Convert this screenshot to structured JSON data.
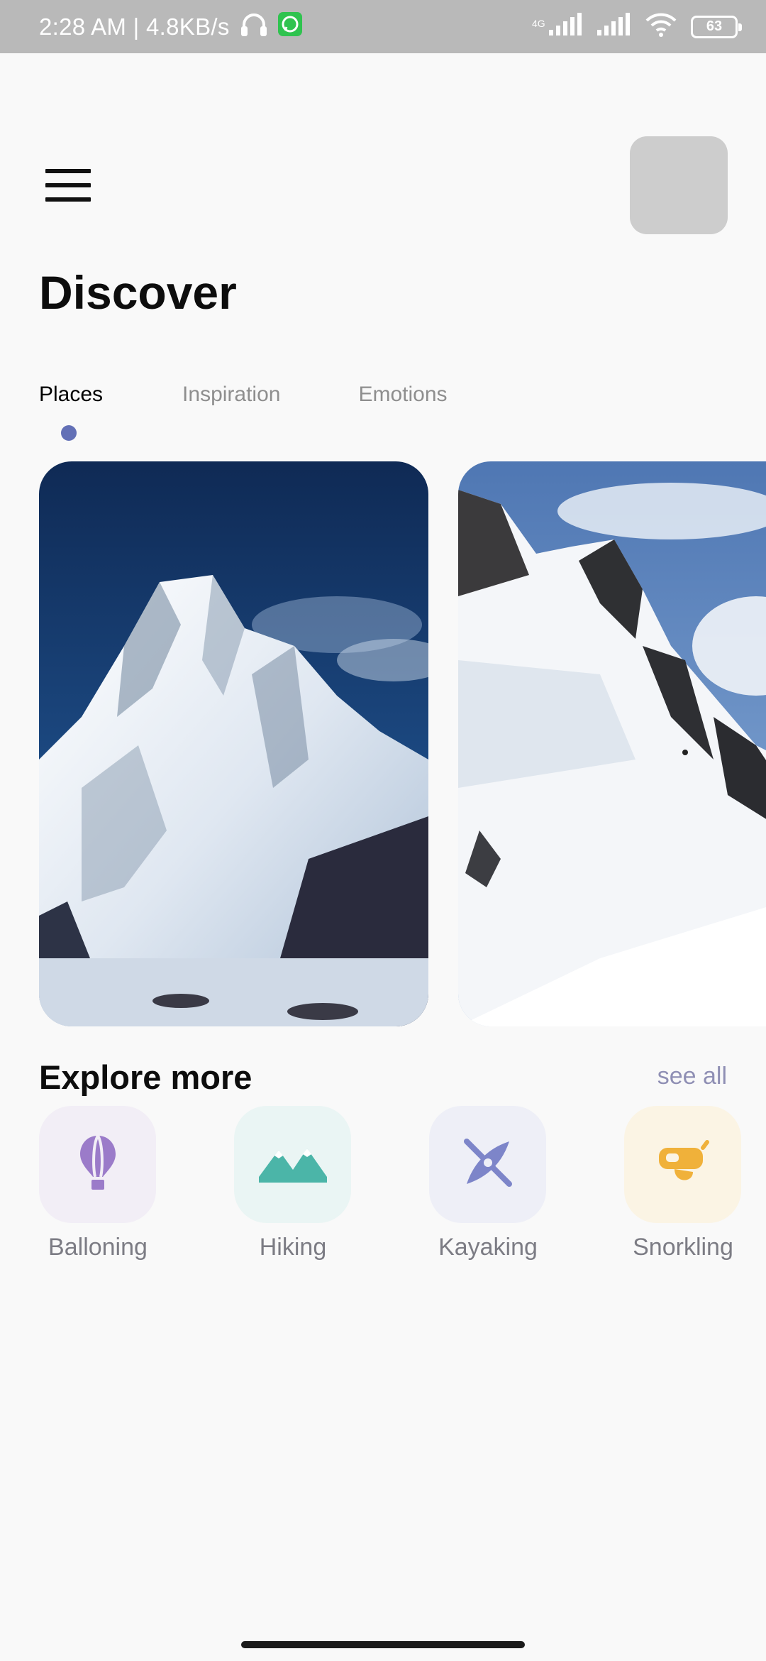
{
  "status_bar": {
    "time_speed": "2:28 AM | 4.8KB/s",
    "network": "4G",
    "battery": "63",
    "icons": [
      "headphones-icon",
      "whatsapp-icon",
      "signal-icon",
      "signal-icon",
      "wifi-icon",
      "battery-icon"
    ]
  },
  "header": {
    "menu_icon": "hamburger-menu-icon",
    "title": "Discover"
  },
  "tabs": [
    {
      "label": "Places",
      "active": true
    },
    {
      "label": "Inspiration",
      "active": false
    },
    {
      "label": "Emotions",
      "active": false
    }
  ],
  "cards": [
    {
      "name": "mountain-peak-photo"
    },
    {
      "name": "snow-ridge-climbers-photo"
    }
  ],
  "explore": {
    "title": "Explore more",
    "see_all": "see all",
    "categories": [
      {
        "label": "Balloning",
        "icon": "hot-air-balloon-icon",
        "color": "#9b7bc9",
        "bg": "#f2eef6"
      },
      {
        "label": "Hiking",
        "icon": "mountains-icon",
        "color": "#4bb5a8",
        "bg": "#eaf5f4"
      },
      {
        "label": "Kayaking",
        "icon": "kayak-icon",
        "color": "#7d85c9",
        "bg": "#eeeff7"
      },
      {
        "label": "Snorkling",
        "icon": "snorkel-mask-icon",
        "color": "#f0b13a",
        "bg": "#fbf4e4"
      }
    ]
  },
  "colors": {
    "accent": "#6370b6",
    "see_all": "#8f8fb4",
    "background": "#f9f9f9"
  }
}
